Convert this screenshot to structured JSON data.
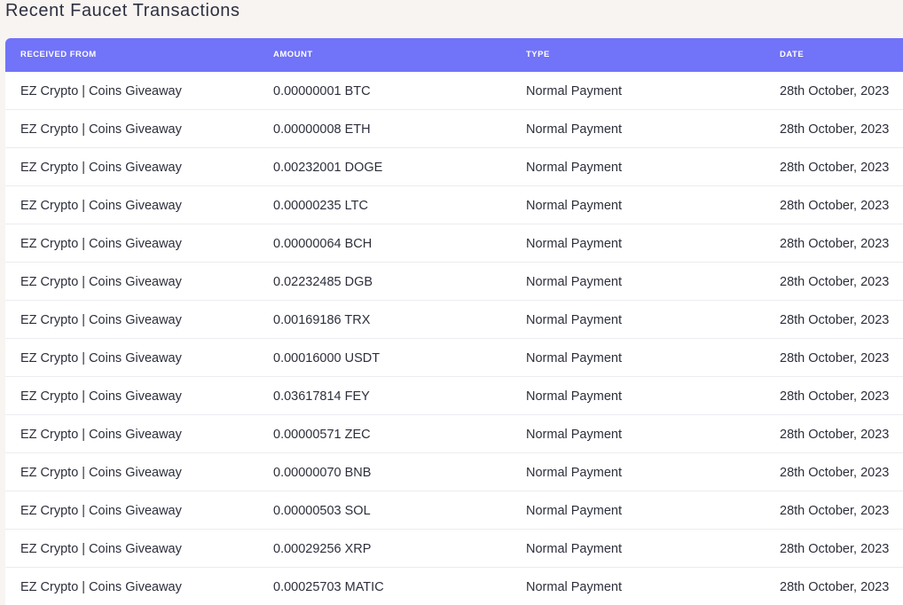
{
  "page": {
    "title": "Recent Faucet Transactions"
  },
  "table": {
    "headers": [
      "RECEIVED FROM",
      "AMOUNT",
      "TYPE",
      "DATE"
    ],
    "rows": [
      {
        "from": "EZ Crypto | Coins Giveaway",
        "amount": "0.00000001 BTC",
        "type": "Normal Payment",
        "date": "28th October, 2023"
      },
      {
        "from": "EZ Crypto | Coins Giveaway",
        "amount": "0.00000008 ETH",
        "type": "Normal Payment",
        "date": "28th October, 2023"
      },
      {
        "from": "EZ Crypto | Coins Giveaway",
        "amount": "0.00232001 DOGE",
        "type": "Normal Payment",
        "date": "28th October, 2023"
      },
      {
        "from": "EZ Crypto | Coins Giveaway",
        "amount": "0.00000235 LTC",
        "type": "Normal Payment",
        "date": "28th October, 2023"
      },
      {
        "from": "EZ Crypto | Coins Giveaway",
        "amount": "0.00000064 BCH",
        "type": "Normal Payment",
        "date": "28th October, 2023"
      },
      {
        "from": "EZ Crypto | Coins Giveaway",
        "amount": "0.02232485 DGB",
        "type": "Normal Payment",
        "date": "28th October, 2023"
      },
      {
        "from": "EZ Crypto | Coins Giveaway",
        "amount": "0.00169186 TRX",
        "type": "Normal Payment",
        "date": "28th October, 2023"
      },
      {
        "from": "EZ Crypto | Coins Giveaway",
        "amount": "0.00016000 USDT",
        "type": "Normal Payment",
        "date": "28th October, 2023"
      },
      {
        "from": "EZ Crypto | Coins Giveaway",
        "amount": "0.03617814 FEY",
        "type": "Normal Payment",
        "date": "28th October, 2023"
      },
      {
        "from": "EZ Crypto | Coins Giveaway",
        "amount": "0.00000571 ZEC",
        "type": "Normal Payment",
        "date": "28th October, 2023"
      },
      {
        "from": "EZ Crypto | Coins Giveaway",
        "amount": "0.00000070 BNB",
        "type": "Normal Payment",
        "date": "28th October, 2023"
      },
      {
        "from": "EZ Crypto | Coins Giveaway",
        "amount": "0.00000503 SOL",
        "type": "Normal Payment",
        "date": "28th October, 2023"
      },
      {
        "from": "EZ Crypto | Coins Giveaway",
        "amount": "0.00029256 XRP",
        "type": "Normal Payment",
        "date": "28th October, 2023"
      },
      {
        "from": "EZ Crypto | Coins Giveaway",
        "amount": "0.00025703 MATIC",
        "type": "Normal Payment",
        "date": "28th October, 2023"
      }
    ]
  },
  "colors": {
    "header_bg": "#7173f8",
    "page_bg": "#f8f4f2",
    "row_border": "#ececf1"
  }
}
